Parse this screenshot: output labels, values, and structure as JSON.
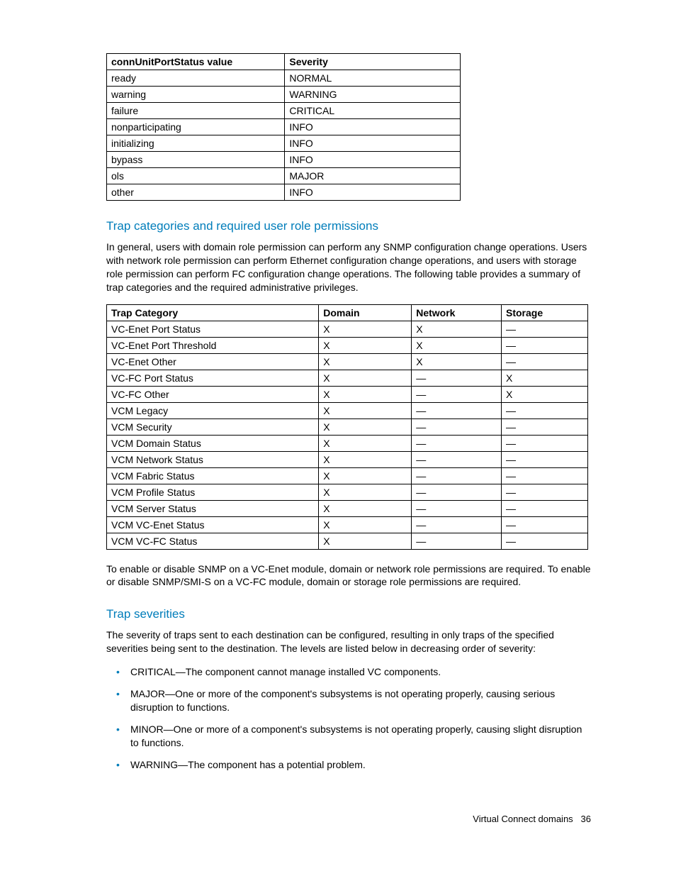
{
  "table1": {
    "headers": [
      "connUnitPortStatus value",
      "Severity"
    ],
    "rows": [
      [
        "ready",
        "NORMAL"
      ],
      [
        "warning",
        "WARNING"
      ],
      [
        "failure",
        "CRITICAL"
      ],
      [
        "nonparticipating",
        "INFO"
      ],
      [
        "initializing",
        "INFO"
      ],
      [
        "bypass",
        "INFO"
      ],
      [
        "ols",
        "MAJOR"
      ],
      [
        "other",
        "INFO"
      ]
    ]
  },
  "section1": {
    "heading": "Trap categories and required user role permissions",
    "para": "In general, users with domain role permission can perform any SNMP configuration change operations. Users with network role permission can perform Ethernet configuration change operations, and users with storage role permission can perform FC configuration change operations. The following table provides a summary of trap categories and the required administrative privileges."
  },
  "table2": {
    "headers": [
      "Trap Category",
      "Domain",
      "Network",
      "Storage"
    ],
    "rows": [
      [
        "VC-Enet Port Status",
        "X",
        "X",
        "—"
      ],
      [
        "VC-Enet Port Threshold",
        "X",
        "X",
        "—"
      ],
      [
        "VC-Enet Other",
        "X",
        "X",
        "—"
      ],
      [
        "VC-FC Port Status",
        "X",
        "—",
        "X"
      ],
      [
        "VC-FC Other",
        "X",
        "—",
        "X"
      ],
      [
        "VCM Legacy",
        "X",
        "—",
        "—"
      ],
      [
        "VCM Security",
        "X",
        "—",
        "—"
      ],
      [
        "VCM Domain Status",
        "X",
        "—",
        "—"
      ],
      [
        "VCM Network Status",
        "X",
        "—",
        "—"
      ],
      [
        "VCM Fabric Status",
        "X",
        "—",
        "—"
      ],
      [
        "VCM Profile Status",
        "X",
        "—",
        "—"
      ],
      [
        "VCM Server Status",
        "X",
        "—",
        "—"
      ],
      [
        "VCM VC-Enet Status",
        "X",
        "—",
        "—"
      ],
      [
        "VCM VC-FC Status",
        "X",
        "—",
        "—"
      ]
    ]
  },
  "para2": "To enable or disable SNMP on a VC-Enet module, domain or network role permissions are required. To enable or disable SNMP/SMI-S on a VC-FC module, domain or storage role permissions are required.",
  "section2": {
    "heading": "Trap severities",
    "para": "The severity of traps sent to each destination can be configured, resulting in only traps of the specified severities being sent to the destination. The levels are listed below in decreasing order of severity:",
    "bullets": [
      "CRITICAL—The component cannot manage installed VC components.",
      "MAJOR—One or more of the component's subsystems is not operating properly, causing serious disruption to functions.",
      "MINOR—One or more of a component's subsystems is not operating properly, causing slight disruption to functions.",
      "WARNING—The component has a potential problem."
    ]
  },
  "footer": {
    "text": "Virtual Connect domains",
    "page": "36"
  }
}
